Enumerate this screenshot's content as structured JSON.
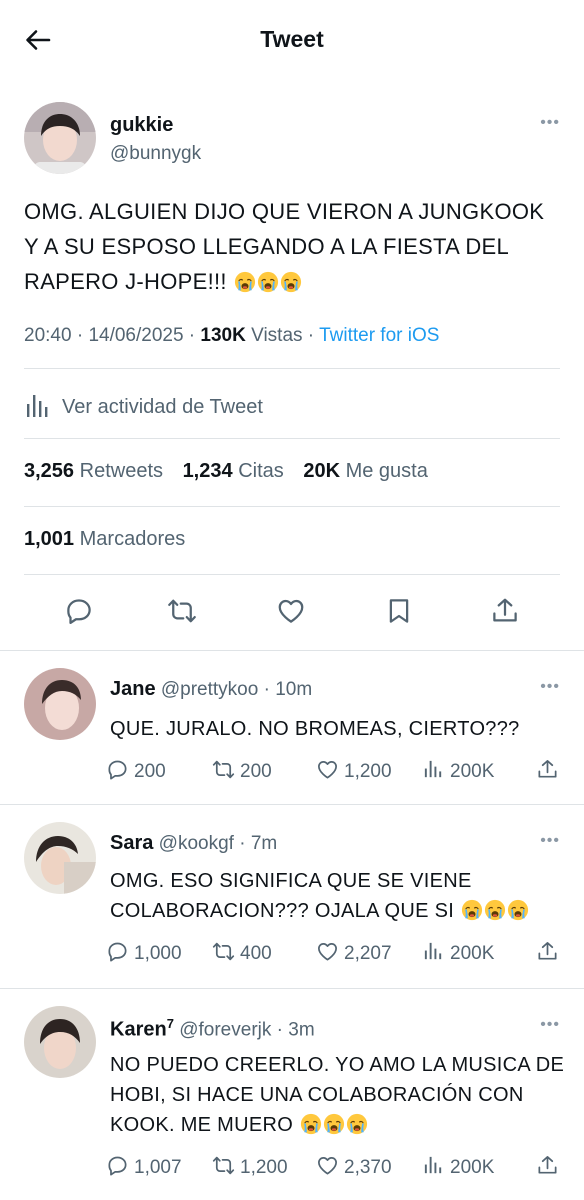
{
  "header": {
    "title": "Tweet",
    "back_icon": "arrow-left-icon"
  },
  "tweet": {
    "name": "gukkie",
    "handle": "@bunnygk",
    "more": "•••",
    "text": "OMG. ALGUIEN DIJO QUE VIERON A JUNGKOOK Y A SU ESPOSO LLEGANDO A LA FIESTA DEL RAPERO J-HOPE!!!",
    "emojis": [
      "loudly-crying-face",
      "loudly-crying-face",
      "loudly-crying-face"
    ],
    "time": "20:40",
    "date": "14/06/2025",
    "views_count": "130K",
    "views_label": "Vistas",
    "client": "Twitter for iOS",
    "activity_label": "Ver actividad de Tweet",
    "retweets_count": "3,256",
    "retweets_label": "Retweets",
    "quotes_count": "1,234",
    "quotes_label": "Citas",
    "likes_count": "20K",
    "likes_label": "Me gusta",
    "bookmarks_count": "1,001",
    "bookmarks_label": "Marcadores"
  },
  "replies": [
    {
      "name": "Jane",
      "handle": "@prettykoo",
      "time": "10m",
      "text": "QUE. JURALO. NO BROMEAS, CIERTO???",
      "replies": "200",
      "retweets": "200",
      "likes": "1,200",
      "views": "200K"
    },
    {
      "name": "Sara",
      "handle": "@kookgf",
      "time": "7m",
      "text": "OMG. ESO SIGNIFICA QUE SE VIENE COLABORACION??? OJALA QUE SI",
      "replies": "1,000",
      "retweets": "400",
      "likes": "2,207",
      "views": "200K"
    },
    {
      "name": "Karen",
      "name_sup": "7",
      "handle": "@foreverjk",
      "time": "3m",
      "text": "NO PUEDO CREERLO. YO AMO LA MUSICA DE HOBI, SI HACE UNA COLABORACIÓN CON KOOK. ME MUERO",
      "replies": "1,007",
      "retweets": "1,200",
      "likes": "2,370",
      "views": "200K"
    }
  ],
  "colors": {
    "link": "#1d9bf0",
    "secondary": "#536471",
    "divider": "#dfe3e6"
  }
}
